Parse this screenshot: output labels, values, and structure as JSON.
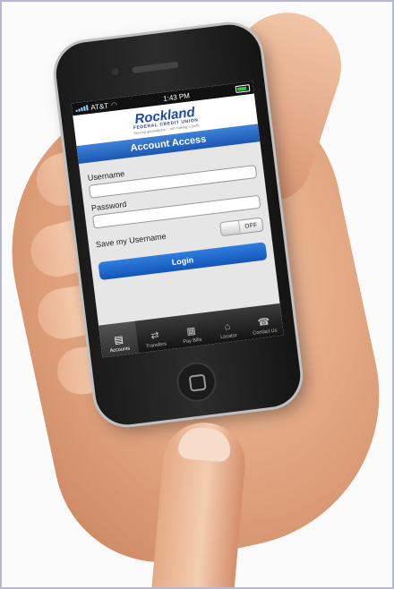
{
  "status_bar": {
    "carrier": "AT&T",
    "time": "1:43 PM"
  },
  "brand": {
    "name": "Rockland",
    "subtitle": "FEDERAL CREDIT UNION",
    "tagline": "Serving generations… not making a profit"
  },
  "header": {
    "title": "Account Access"
  },
  "form": {
    "username_label": "Username",
    "username_value": "",
    "password_label": "Password",
    "password_value": "",
    "save_username_label": "Save my Username",
    "save_username_toggle": "OFF",
    "login_label": "Login"
  },
  "tabs": [
    {
      "label": "Accounts",
      "icon": "accounts-icon",
      "active": true
    },
    {
      "label": "Transfers",
      "icon": "transfers-icon",
      "active": false
    },
    {
      "label": "Pay Bills",
      "icon": "pay-bills-icon",
      "active": false
    },
    {
      "label": "Locator",
      "icon": "locator-icon",
      "active": false
    },
    {
      "label": "Contact Us",
      "icon": "contact-us-icon",
      "active": false
    }
  ],
  "colors": {
    "brand_blue": "#1d4aa3",
    "header_blue": "#1b57b4",
    "button_blue": "#2f7ee0"
  }
}
